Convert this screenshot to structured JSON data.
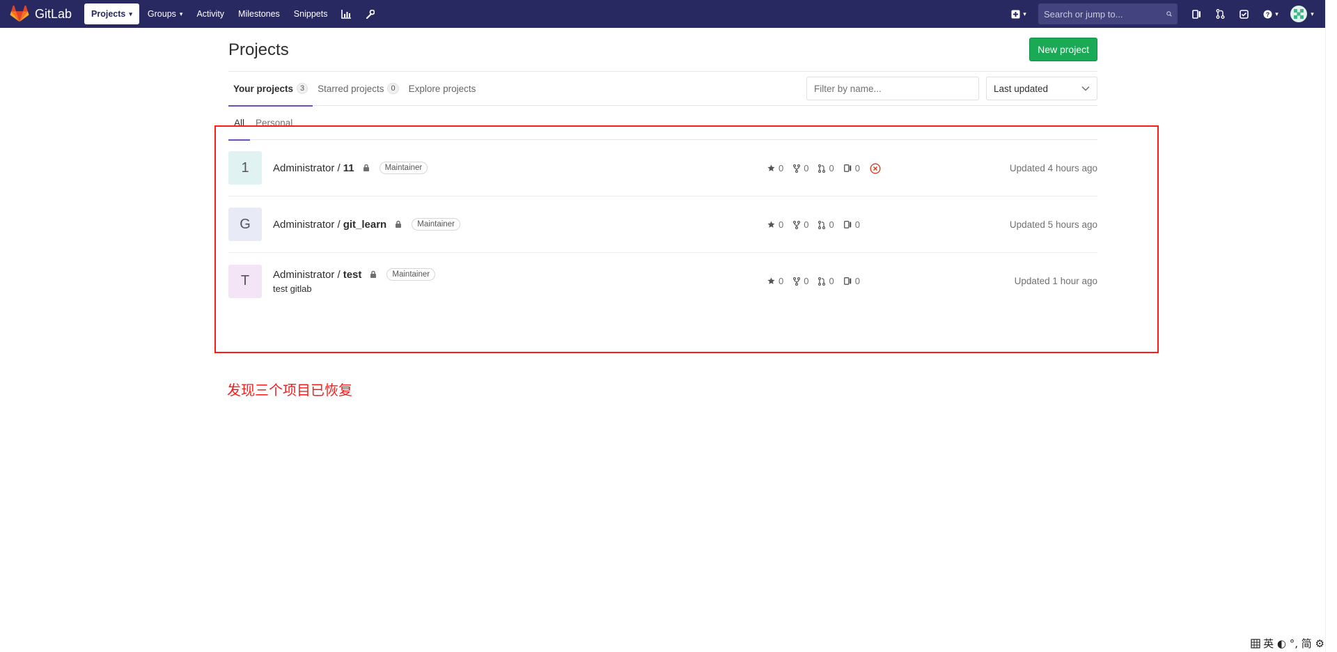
{
  "navbar": {
    "brand": "GitLab",
    "links": [
      {
        "label": "Projects",
        "active": true,
        "caret": true
      },
      {
        "label": "Groups",
        "active": false,
        "caret": true
      },
      {
        "label": "Activity",
        "active": false,
        "caret": false
      },
      {
        "label": "Milestones",
        "active": false,
        "caret": false
      },
      {
        "label": "Snippets",
        "active": false,
        "caret": false
      }
    ],
    "search_placeholder": "Search or jump to...",
    "bg_color": "#292961"
  },
  "page": {
    "title": "Projects",
    "new_project_label": "New project",
    "tabs": [
      {
        "label": "Your projects",
        "count": "3",
        "active": true
      },
      {
        "label": "Starred projects",
        "count": "0",
        "active": false
      },
      {
        "label": "Explore projects",
        "count": "",
        "active": false
      }
    ],
    "filter_placeholder": "Filter by name...",
    "sort_label": "Last updated",
    "subtabs": [
      {
        "label": "All",
        "active": true
      },
      {
        "label": "Personal",
        "active": false
      }
    ]
  },
  "projects": [
    {
      "letter": "1",
      "namespace": "Administrator /",
      "name": "11",
      "role": "Maintainer",
      "description": "",
      "stars": "0",
      "forks": "0",
      "merge_requests": "0",
      "issues": "0",
      "pipeline_failed": true,
      "updated": "Updated 4 hours ago",
      "avatar_color": "#e0f2f1"
    },
    {
      "letter": "G",
      "namespace": "Administrator /",
      "name": "git_learn",
      "role": "Maintainer",
      "description": "",
      "stars": "0",
      "forks": "0",
      "merge_requests": "0",
      "issues": "0",
      "pipeline_failed": false,
      "updated": "Updated 5 hours ago",
      "avatar_color": "#e8eaf6"
    },
    {
      "letter": "T",
      "namespace": "Administrator /",
      "name": "test",
      "role": "Maintainer",
      "description": "test gitlab",
      "stars": "0",
      "forks": "0",
      "merge_requests": "0",
      "issues": "0",
      "pipeline_failed": false,
      "updated": "Updated 1 hour ago",
      "avatar_color": "#f3e5f5"
    }
  ],
  "annotation": {
    "text": "发现三个项目已恢复",
    "color": "#ff1a1a"
  },
  "ime_bar": {
    "text": "英 ◐ °, 简 ⚙"
  }
}
